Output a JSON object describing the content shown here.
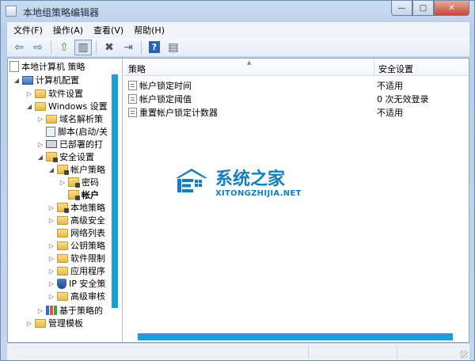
{
  "window": {
    "title": "本地组策略编辑器",
    "controls": {
      "minimize": "—",
      "maximize": "□",
      "close": "✕"
    }
  },
  "menu": [
    {
      "label": "文件(F)"
    },
    {
      "label": "操作(A)"
    },
    {
      "label": "查看(V)"
    },
    {
      "label": "帮助(H)"
    }
  ],
  "toolbar": {
    "back": "⇦",
    "forward": "⇨",
    "up": "⇧",
    "show_hide_tree": "▥",
    "delete": "✖",
    "export": "⇥",
    "help": "?",
    "properties": "▤"
  },
  "tree": [
    {
      "label": "本地计算机 策略",
      "icon": "policy-icon"
    },
    {
      "label": "计算机配置",
      "icon": "computer-icon"
    },
    {
      "label": "软件设置",
      "icon": "folder-icon"
    },
    {
      "label": "Windows 设置",
      "icon": "folder-icon"
    },
    {
      "label": "域名解析策",
      "icon": "folder-icon"
    },
    {
      "label": "脚本(启动/关",
      "icon": "script-icon"
    },
    {
      "label": "已部署的打",
      "icon": "printer-icon"
    },
    {
      "label": "安全设置",
      "icon": "lock-folder-icon"
    },
    {
      "label": "帐户策略",
      "icon": "lock-folder-icon"
    },
    {
      "label": "密码",
      "icon": "lock-folder-icon"
    },
    {
      "label": "帐户",
      "icon": "lock-folder-icon"
    },
    {
      "label": "本地策略",
      "icon": "lock-folder-icon"
    },
    {
      "label": "高级安全",
      "icon": "folder-icon"
    },
    {
      "label": "网络列表",
      "icon": "folder-icon"
    },
    {
      "label": "公钥策略",
      "icon": "folder-icon"
    },
    {
      "label": "软件限制",
      "icon": "folder-icon"
    },
    {
      "label": "应用程序",
      "icon": "folder-icon"
    },
    {
      "label": "IP 安全策",
      "icon": "shield-icon"
    },
    {
      "label": "高级审核",
      "icon": "folder-icon"
    },
    {
      "label": "基于策略的",
      "icon": "chart-icon"
    },
    {
      "label": "管理模板",
      "icon": "folder-icon"
    }
  ],
  "list": {
    "columns": [
      "策略",
      "安全设置"
    ],
    "rows": [
      {
        "policy": "帐户锁定时间",
        "setting": "不适用"
      },
      {
        "policy": "帐户锁定阈值",
        "setting": "0 次无效登录"
      },
      {
        "policy": "重置帐户锁定计数器",
        "setting": "不适用"
      }
    ]
  },
  "watermark": {
    "title": "系统之家",
    "subtitle": "XITONGZHIJIA.NET"
  },
  "colors": {
    "accent": "#1a9fd6",
    "watermark": "#0f7fc4"
  }
}
